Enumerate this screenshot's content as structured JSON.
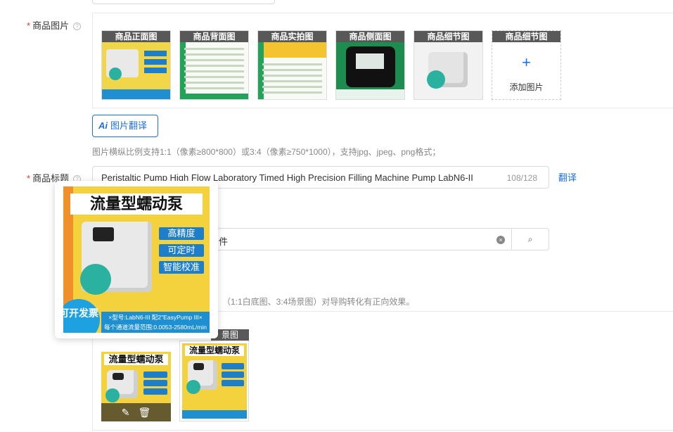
{
  "product_images": {
    "label": "商品图片",
    "help": "?",
    "thumbs": [
      {
        "caption": "商品正面图"
      },
      {
        "caption": "商品背面图"
      },
      {
        "caption": "商品实拍图"
      },
      {
        "caption": "商品侧面图"
      },
      {
        "caption": "商品细节图"
      },
      {
        "caption": "商品细节图"
      }
    ],
    "add_label": "添加图片",
    "add_icon": "+",
    "translate_icon": "Ai",
    "translate_button": "图片翻译",
    "hint": "图片横纵比例支持1:1（像素≥800*800）或3:4（像素≥750*1000），支持jpg、jpeg、png格式；"
  },
  "product_title": {
    "label": "商品标题",
    "help": "?",
    "value": "Peristaltic Pump High Flow Laboratory Timed High Precision Filling Machine Pump LabN6-II",
    "counter": "108/128",
    "translate_link": "翻译"
  },
  "search": {
    "value": "件",
    "clear_icon": "×",
    "search_icon": "⌕"
  },
  "hint2": "（1:1白底图、3:4场景图）对导购转化有正向效果。",
  "scene_caption": "景图",
  "poster": {
    "title": "流量型蠕动泵",
    "tags": [
      "高精度",
      "可定时",
      "智能校准"
    ],
    "badge": "可开发票",
    "band_line1": "×型号:LabN6-III 配2\"EasyPump III×",
    "band_line2": "每个通道流量范围:0.0053-2580mL/min"
  },
  "tools": {
    "edit_icon": "✎",
    "delete_icon": "🗑"
  }
}
